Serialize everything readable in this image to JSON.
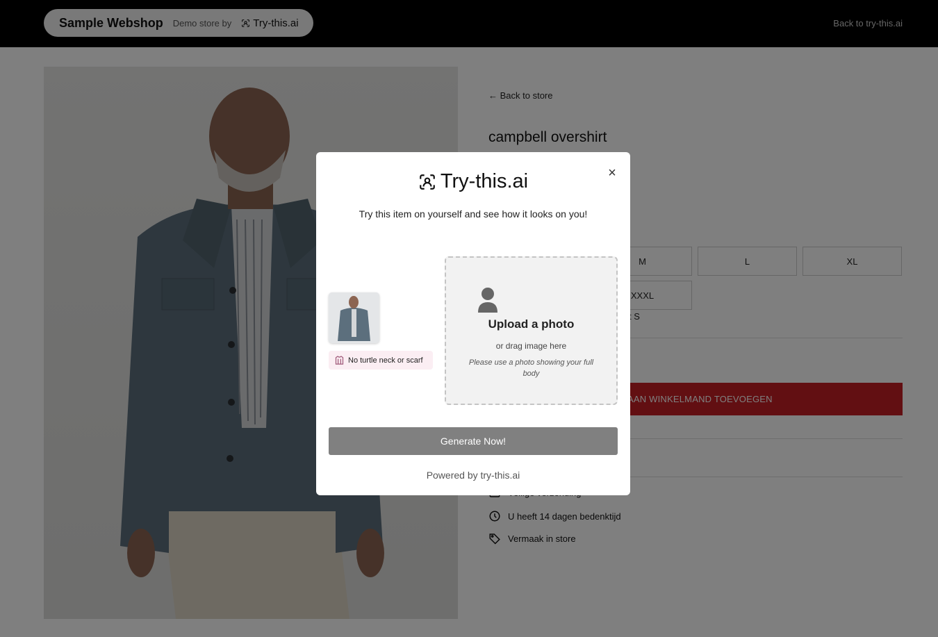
{
  "header": {
    "brand": "Sample Webshop",
    "demo_by": "Demo store by",
    "logo_text": "Try-this.ai",
    "back_link": "Back to try-this.ai"
  },
  "product": {
    "back_to_store": "← Back to store",
    "title": "campbell overshirt",
    "sizes_row1": [
      "M",
      "L",
      "XL"
    ],
    "sizes_row2": [
      "XXXL"
    ],
    "size_note": "t S",
    "add_to_cart": "AAN WINKELMAND TOEVOEGEN",
    "features": [
      {
        "icon": "box-icon",
        "text": "Veilige verzending"
      },
      {
        "icon": "clock-icon",
        "text": "U heeft 14 dagen bedenktijd"
      },
      {
        "icon": "tag-icon",
        "text": "Vermaak in store"
      }
    ]
  },
  "modal": {
    "logo_text": "Try-this.ai",
    "close_label": "×",
    "subtitle": "Try this item on yourself and see how it looks on you!",
    "badge": "No turtle neck or scarf",
    "upload_title": "Upload a photo",
    "upload_sub": "or drag image here",
    "upload_hint": "Please use a photo showing your full body",
    "generate": "Generate Now!",
    "powered": "Powered by try-this.ai"
  },
  "colors": {
    "header_bg": "#000000",
    "cart_red": "#c41e24",
    "generate_btn": "#808080",
    "badge_bg": "#fbeef3"
  }
}
